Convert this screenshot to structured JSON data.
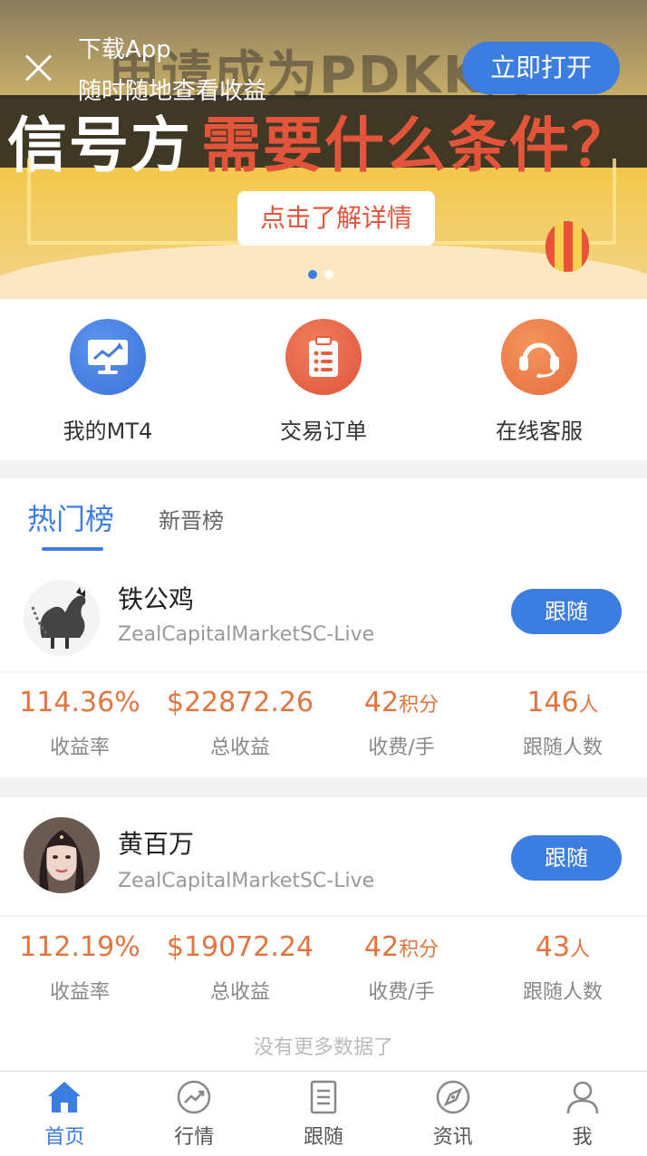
{
  "app_banner": {
    "title": "下载App",
    "subtitle": "随时随地查看收益",
    "open_label": "立即打开"
  },
  "promo": {
    "headline_top": "申请成为PDKK的",
    "headline_white": "信号方",
    "headline_red": "需要什么条件？",
    "cta": "点击了解详情",
    "slide_count": 2,
    "active_slide": 1
  },
  "quick_menu": [
    {
      "label": "我的MT4",
      "icon": "monitor-chart-icon",
      "color": "#3f7be0"
    },
    {
      "label": "交易订单",
      "icon": "clipboard-list-icon",
      "color": "#e6603f"
    },
    {
      "label": "在线客服",
      "icon": "headset-icon",
      "color": "#eb7a44"
    }
  ],
  "tabs": [
    {
      "label": "热门榜",
      "active": true
    },
    {
      "label": "新晋榜",
      "active": false
    }
  ],
  "traders": [
    {
      "name": "铁公鸡",
      "server": "ZealCapitalMarketSC-Live",
      "follow_label": "跟随",
      "stats": [
        {
          "value": "114.36%",
          "unit": "",
          "label": "收益率"
        },
        {
          "value": "$22872.26",
          "unit": "",
          "label": "总收益"
        },
        {
          "value": "42",
          "unit": "积分",
          "label": "收费/手"
        },
        {
          "value": "146",
          "unit": "人",
          "label": "跟随人数"
        }
      ]
    },
    {
      "name": "黄百万",
      "server": "ZealCapitalMarketSC-Live",
      "follow_label": "跟随",
      "stats": [
        {
          "value": "112.19%",
          "unit": "",
          "label": "收益率"
        },
        {
          "value": "$19072.24",
          "unit": "",
          "label": "总收益"
        },
        {
          "value": "42",
          "unit": "积分",
          "label": "收费/手"
        },
        {
          "value": "43",
          "unit": "人",
          "label": "跟随人数"
        }
      ]
    }
  ],
  "no_more_text": "没有更多数据了",
  "bottom_nav": [
    {
      "label": "首页",
      "icon": "home-icon",
      "active": true
    },
    {
      "label": "行情",
      "icon": "trend-icon",
      "active": false
    },
    {
      "label": "跟随",
      "icon": "document-icon",
      "active": false
    },
    {
      "label": "资讯",
      "icon": "compass-icon",
      "active": false
    },
    {
      "label": "我",
      "icon": "user-icon",
      "active": false
    }
  ],
  "colors": {
    "accent": "#3b7de0",
    "stat_value": "#e2743f"
  }
}
